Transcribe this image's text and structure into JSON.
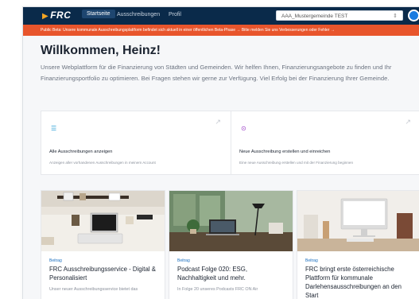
{
  "colors": {
    "nav_bg": "#0a2a4a",
    "banner_bg": "#e8552c",
    "accent": "#1a7be0"
  },
  "nav": {
    "logo": "FRC",
    "items": [
      {
        "label": "Startseite",
        "active": true
      },
      {
        "label": "Ausschreibungen",
        "active": false
      },
      {
        "label": "Profil",
        "active": false
      }
    ],
    "municipality_select": "AAA_Mustergemeinde TEST"
  },
  "banner": {
    "text": "Public Beta: Unsere kommunale Ausschreibungsplattform befindet sich aktuell in einer öffentlichen Beta-Phase → Bitte melden Sie uns Verbesserungen oder Fehler →"
  },
  "welcome": {
    "title": "Willkommen, Heinz!",
    "intro": "Unsere Webplattform für die Finanzierung von Städten und Gemeinden. Wir helfen Ihnen, Finanzierungsangebote zu finden und Ihr Finanzierungsportfolio zu optimieren. Bei Fragen stehen wir gerne zur Verfügung. Viel Erfolg bei der Finanzierung Ihrer Gemeinde."
  },
  "quick_actions": [
    {
      "icon": "list-icon",
      "title": "Alle Ausschreibungen anzeigen",
      "description": "Anzeigen aller vorhandenen Ausschreibungen in meinem Account"
    },
    {
      "icon": "plus-circle-icon",
      "title": "Neue Ausschreibung erstellen und einreichen",
      "description": "Eine neue Ausschreibung erstellen und mit der Finanzierung beginnen"
    }
  ],
  "articles": [
    {
      "tag": "Beitrag",
      "title": "FRC Ausschreibungsservice - Digital & Personalisiert",
      "excerpt": "Unser neuer Ausschreibungsservice bietet das"
    },
    {
      "tag": "Beitrag",
      "title": "Podcast Folge 020: ESG, Nachhaltigkeit und mehr.",
      "excerpt": "In Folge 20 unseres Podcasts FRC ON Air"
    },
    {
      "tag": "Beitrag",
      "title": "FRC bringt erste österreichische Plattform für kommunale Darlehensausschreibungen an den Start",
      "excerpt": ""
    }
  ]
}
